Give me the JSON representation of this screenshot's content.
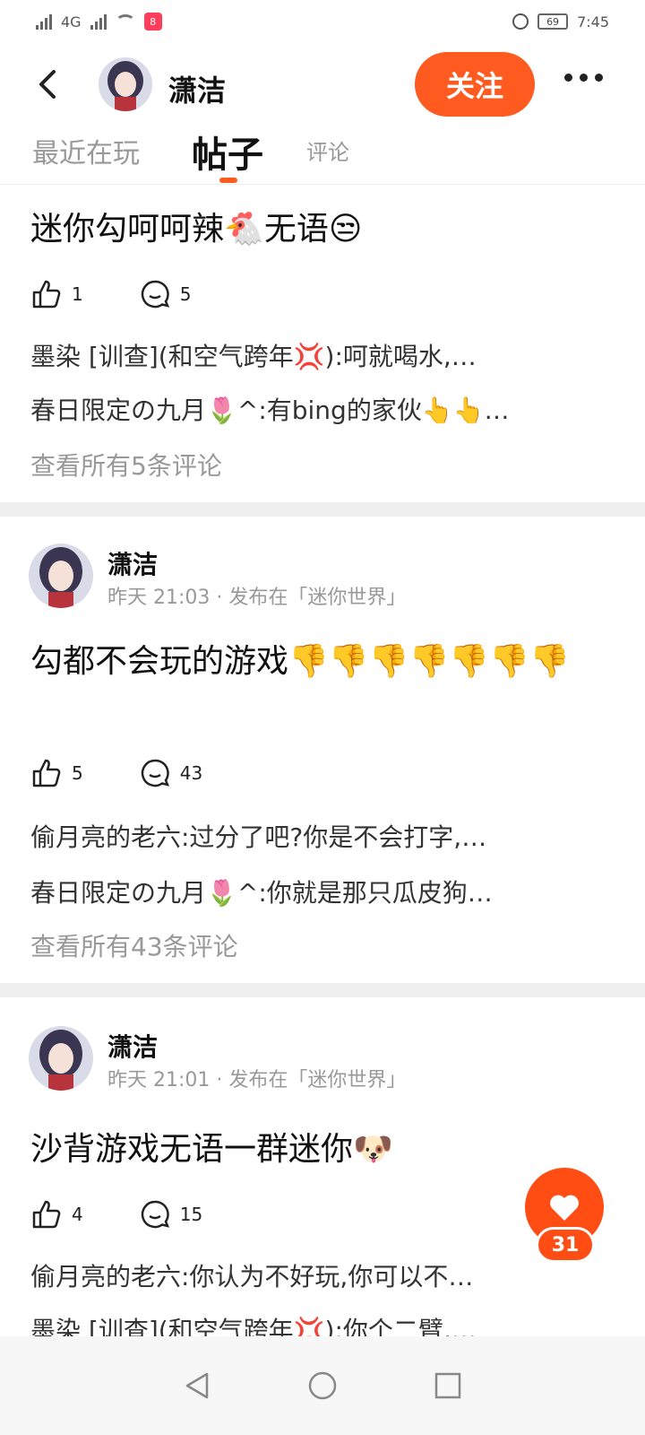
{
  "status": {
    "network": "4G",
    "battery": "69",
    "time": "7:45"
  },
  "header": {
    "back": "<",
    "name": "潇洁",
    "follow": "关注"
  },
  "tabs": [
    {
      "label": "最近在玩"
    },
    {
      "label": "帖子"
    },
    {
      "label": "评论"
    }
  ],
  "posts": [
    {
      "title": "迷你勾呵呵辣🐔无语😒",
      "likes": "1",
      "comments": "5",
      "comment_lines": [
        "墨染 [训查](和空气跨年💢):呵就喝水,…",
        "春日限定の九月🌷^:有bing的家伙👆👆…"
      ],
      "view_all": "查看所有5条评论"
    },
    {
      "author": "潇洁",
      "meta": "昨天 21:03 · 发布在「迷你世界」",
      "title": "勾都不会玩的游戏👎👎👎👎👎👎👎",
      "likes": "5",
      "comments": "43",
      "comment_lines": [
        "偷月亮的老六:过分了吧?你是不会打字,…",
        "春日限定の九月🌷^:你就是那只瓜皮狗…"
      ],
      "view_all": "查看所有43条评论"
    },
    {
      "author": "潇洁",
      "meta": "昨天 21:01 · 发布在「迷你世界」",
      "title": "沙背游戏无语一群迷你🐶",
      "likes": "4",
      "comments": "15",
      "comment_lines": [
        "偷月亮的老六:你认为不好玩,你可以不…",
        "墨染 [训查](和空气跨年💢):你个二臂,…"
      ]
    }
  ],
  "fab": {
    "count": "31"
  },
  "colors": {
    "accent": "#ff5a1f",
    "divider": "#efefef"
  }
}
